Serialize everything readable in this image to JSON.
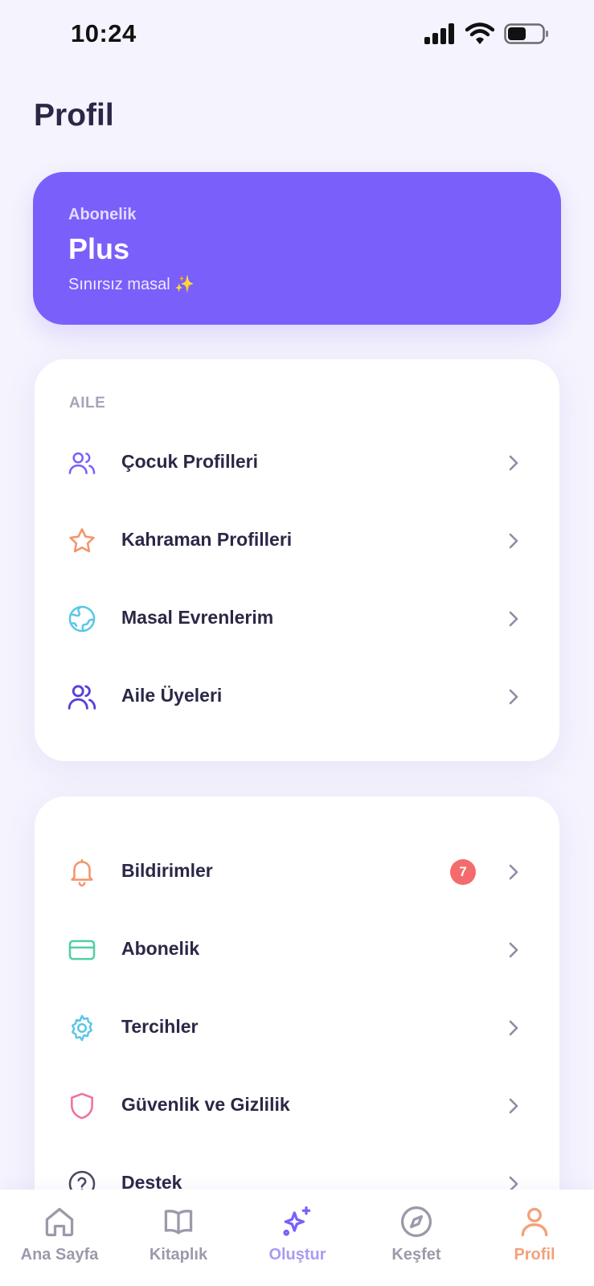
{
  "status_bar": {
    "time": "10:24"
  },
  "page": {
    "title": "Profil"
  },
  "subscription_card": {
    "label": "Abonelik",
    "plan": "Plus",
    "description": "Sınırsız masal ✨"
  },
  "family_section": {
    "title": "AILE",
    "items": [
      {
        "label": "Çocuk Profilleri",
        "icon": "users-icon",
        "color": "#7b5ffb"
      },
      {
        "label": "Kahraman Profilleri",
        "icon": "star-icon",
        "color": "#f4946a"
      },
      {
        "label": "Masal Evrenlerim",
        "icon": "globe-icon",
        "color": "#5cc6e6"
      },
      {
        "label": "Aile Üyeleri",
        "icon": "user-group-icon",
        "color": "#5a3fd8"
      }
    ]
  },
  "settings_section": {
    "items": [
      {
        "label": "Bildirimler",
        "icon": "bell-icon",
        "color": "#f4946a",
        "badge": "7"
      },
      {
        "label": "Abonelik",
        "icon": "credit-card-icon",
        "color": "#4fcfa5"
      },
      {
        "label": "Tercihler",
        "icon": "gear-icon",
        "color": "#5cc6e6"
      },
      {
        "label": "Güvenlik ve Gizlilik",
        "icon": "shield-icon",
        "color": "#f0709a"
      },
      {
        "label": "Destek",
        "icon": "help-circle-icon",
        "color": "#4a4860"
      }
    ]
  },
  "tab_bar": {
    "tabs": [
      {
        "label": "Ana Sayfa",
        "icon": "home-icon"
      },
      {
        "label": "Kitaplık",
        "icon": "book-icon"
      },
      {
        "label": "Oluştur",
        "icon": "sparkles-icon"
      },
      {
        "label": "Keşfet",
        "icon": "compass-icon"
      },
      {
        "label": "Profil",
        "icon": "user-icon",
        "active": true
      }
    ]
  },
  "colors": {
    "background": "#f5f3fd",
    "accent": "#7b5ffb",
    "active_tab": "#f4a07a",
    "badge": "#f36b6b"
  }
}
